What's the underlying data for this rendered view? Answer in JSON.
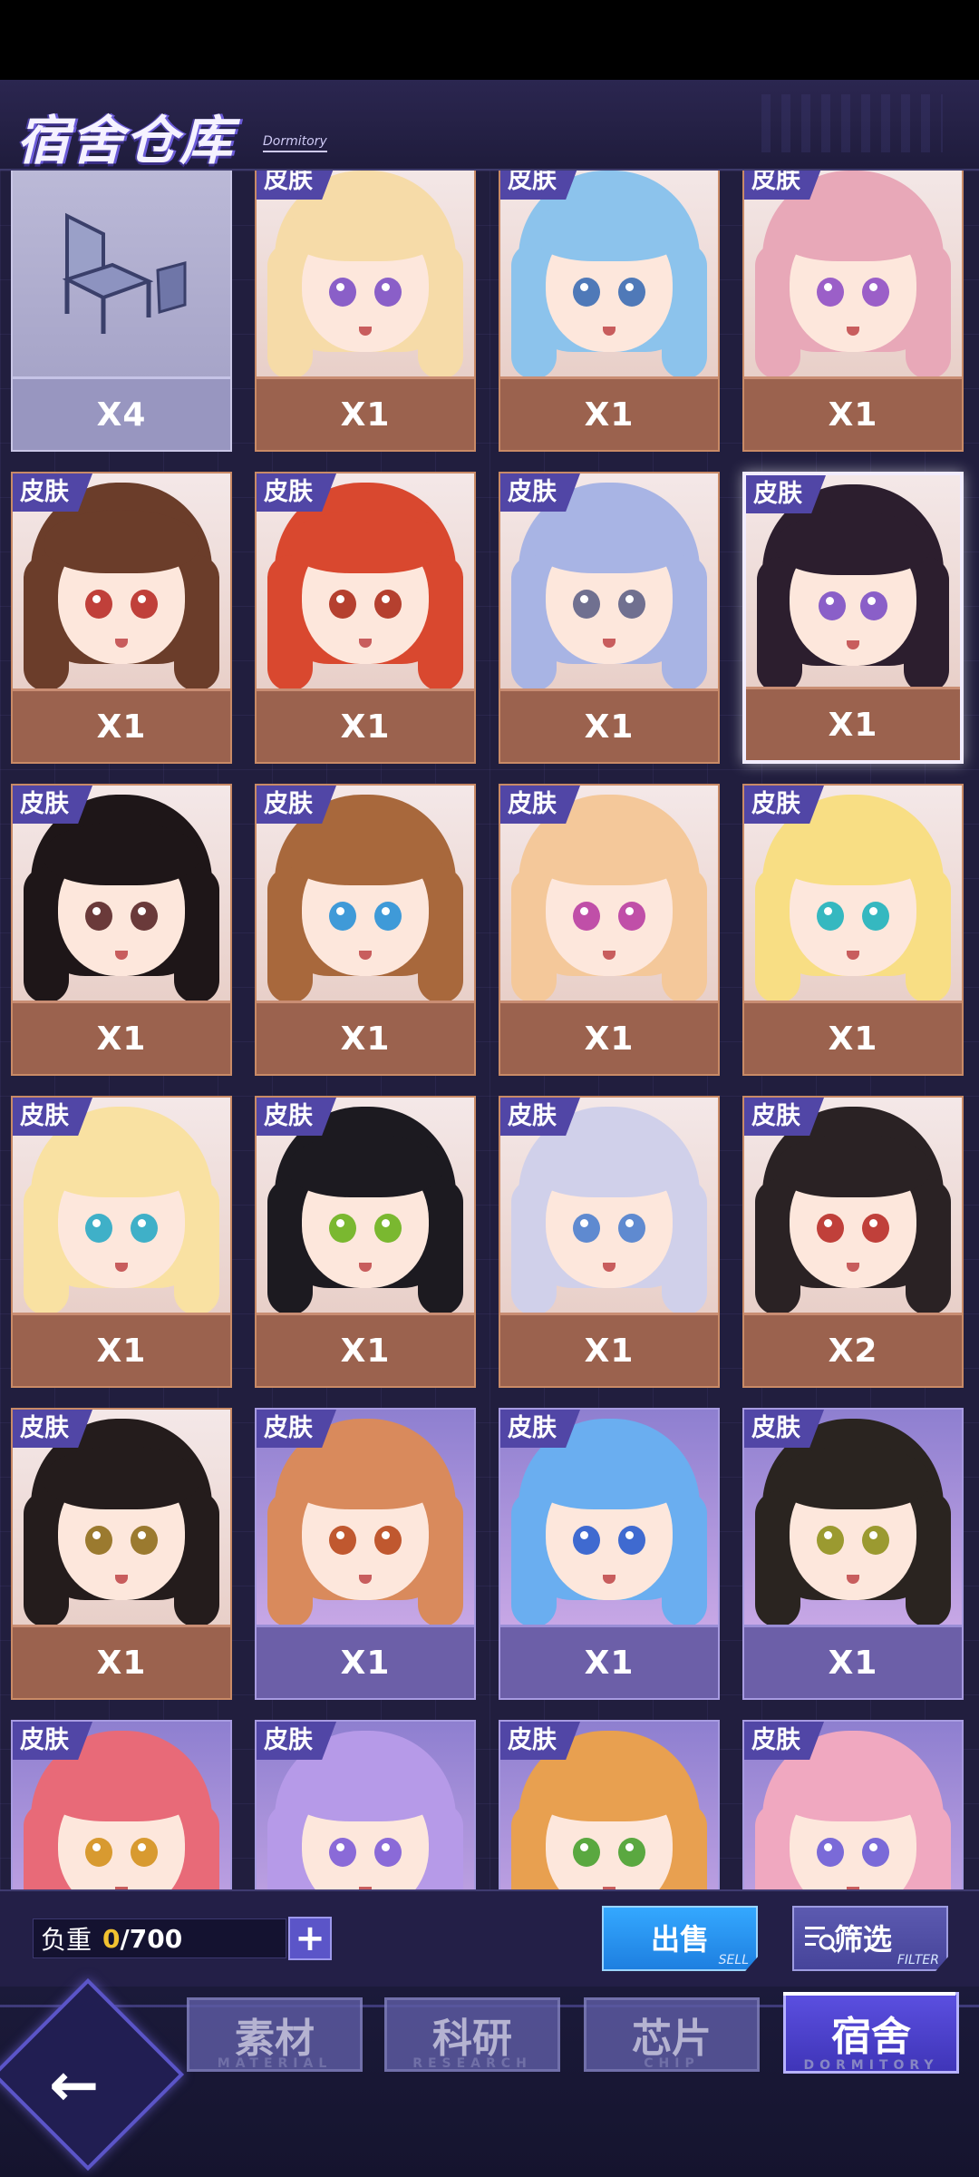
{
  "header": {
    "title": "宿舍仓库",
    "subtitle": "Dormitory"
  },
  "items": [
    {
      "kind": "furniture",
      "tag": "",
      "qty": "X4"
    },
    {
      "kind": "skin",
      "tag": "皮肤",
      "qty": "X1",
      "hair": "#f6dba8",
      "eye": "#8a5fc8"
    },
    {
      "kind": "skin",
      "tag": "皮肤",
      "qty": "X1",
      "hair": "#8cc3ec",
      "eye": "#4f79b8"
    },
    {
      "kind": "skin",
      "tag": "皮肤",
      "qty": "X1",
      "hair": "#e8a8b8",
      "eye": "#9b5fc8"
    },
    {
      "kind": "skin",
      "tag": "皮肤",
      "qty": "X1",
      "hair": "#6b3d2a",
      "eye": "#c0403a"
    },
    {
      "kind": "skin",
      "tag": "皮肤",
      "qty": "X1",
      "hair": "#d9482f",
      "eye": "#b5402f"
    },
    {
      "kind": "skin",
      "tag": "皮肤",
      "qty": "X1",
      "hair": "#a8b4e4",
      "eye": "#707090"
    },
    {
      "kind": "skin",
      "tag": "皮肤",
      "qty": "X1",
      "hair": "#2c1e2e",
      "eye": "#8a5fc8",
      "selected": true
    },
    {
      "kind": "skin",
      "tag": "皮肤",
      "qty": "X1",
      "hair": "#1e1618",
      "eye": "#6a3a3a"
    },
    {
      "kind": "skin",
      "tag": "皮肤",
      "qty": "X1",
      "hair": "#a8683c",
      "eye": "#3f9ad8"
    },
    {
      "kind": "skin",
      "tag": "皮肤",
      "qty": "X1",
      "hair": "#f4c89a",
      "eye": "#c04fa8"
    },
    {
      "kind": "skin",
      "tag": "皮肤",
      "qty": "X1",
      "hair": "#f8de84",
      "eye": "#35b8c0"
    },
    {
      "kind": "skin",
      "tag": "皮肤",
      "qty": "X1",
      "hair": "#f9e1a2",
      "eye": "#3fb0c8"
    },
    {
      "kind": "skin",
      "tag": "皮肤",
      "qty": "X1",
      "hair": "#1c1a20",
      "eye": "#7ab830"
    },
    {
      "kind": "skin",
      "tag": "皮肤",
      "qty": "X1",
      "hair": "#d0d0ea",
      "eye": "#5f8ad0"
    },
    {
      "kind": "skin",
      "tag": "皮肤",
      "qty": "X2",
      "hair": "#2a2224",
      "eye": "#c0403a"
    },
    {
      "kind": "skin",
      "tag": "皮肤",
      "qty": "X1",
      "hair": "#241c1c",
      "eye": "#9b7a2f"
    },
    {
      "kind": "skin",
      "tag": "皮肤",
      "qty": "X1",
      "hair": "#d98a5c",
      "eye": "#c0582f",
      "purple": true
    },
    {
      "kind": "skin",
      "tag": "皮肤",
      "qty": "X1",
      "hair": "#6aaef0",
      "eye": "#3f6ad0",
      "purple": true
    },
    {
      "kind": "skin",
      "tag": "皮肤",
      "qty": "X1",
      "hair": "#2a2420",
      "eye": "#9b9a30",
      "purple": true
    },
    {
      "kind": "skin",
      "tag": "皮肤",
      "qty": "",
      "hair": "#e86a78",
      "eye": "#d89a30",
      "purple": true
    },
    {
      "kind": "skin",
      "tag": "皮肤",
      "qty": "",
      "hair": "#b69ae8",
      "eye": "#8a6ad8",
      "purple": true
    },
    {
      "kind": "skin",
      "tag": "皮肤",
      "qty": "",
      "hair": "#e8a050",
      "eye": "#5aa840",
      "purple": true
    },
    {
      "kind": "skin",
      "tag": "皮肤",
      "qty": "",
      "hair": "#f0a8c0",
      "eye": "#7a6ad8",
      "purple": true
    }
  ],
  "capacity": {
    "label": "负重",
    "current": "0",
    "max": "/700",
    "plus": "+"
  },
  "actions": {
    "sell_label": "出售",
    "sell_sub": "SELL",
    "filter_label": "筛选",
    "filter_sub": "FILTER"
  },
  "nav": {
    "back": "←",
    "tabs": [
      {
        "label": "素材",
        "sub": "MATERIAL"
      },
      {
        "label": "科研",
        "sub": "RESEARCH"
      },
      {
        "label": "芯片",
        "sub": "CHIP"
      },
      {
        "label": "宿舍",
        "sub": "DORMITORY",
        "active": true
      }
    ]
  },
  "colors": {
    "skin_tag_bg": "#5146a6",
    "qty_bar_brown": "#9b624e",
    "qty_bar_purple": "#6c5fa8",
    "sell_blue": "#1e7fe0",
    "capacity_current": "#f2c230"
  }
}
